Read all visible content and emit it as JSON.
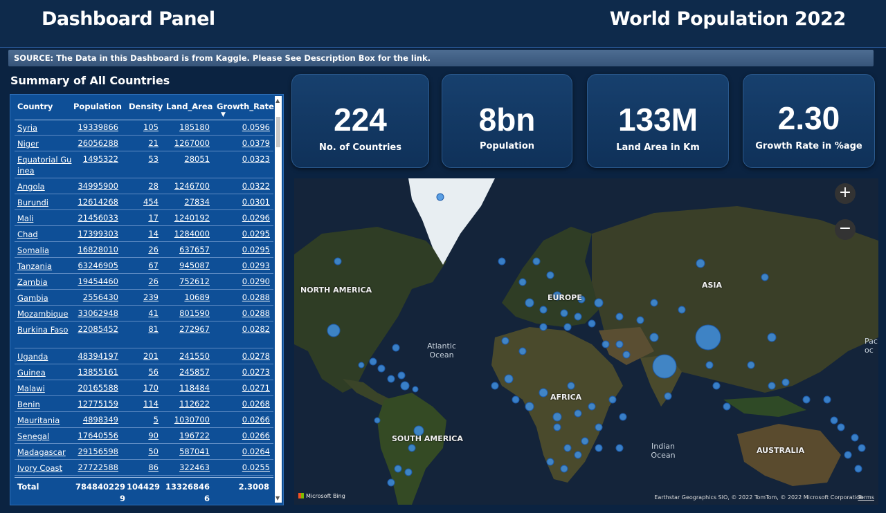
{
  "header": {
    "left_title": "Dashboard Panel",
    "right_title": "World Population 2022"
  },
  "source_text": "SOURCE: The Data in this Dashboard is from Kaggle. Please See Description Box for the link.",
  "summary": {
    "title": "Summary of All Countries",
    "columns": [
      "Country",
      "Population",
      "Density",
      "Land_Area",
      "Growth_Rate"
    ],
    "sorted_column": "Growth_Rate",
    "rows": [
      {
        "country": "Syria",
        "population": "19339866",
        "density": "105",
        "land_area": "185180",
        "growth_rate": "0.0596"
      },
      {
        "country": "Niger",
        "population": "26056288",
        "density": "21",
        "land_area": "1267000",
        "growth_rate": "0.0379"
      },
      {
        "country": "Equatorial Guinea",
        "population": "1495322",
        "density": "53",
        "land_area": "28051",
        "growth_rate": "0.0323"
      },
      {
        "country": "Angola",
        "population": "34995900",
        "density": "28",
        "land_area": "1246700",
        "growth_rate": "0.0322"
      },
      {
        "country": "Burundi",
        "population": "12614268",
        "density": "454",
        "land_area": "27834",
        "growth_rate": "0.0301"
      },
      {
        "country": "Mali",
        "population": "21456033",
        "density": "17",
        "land_area": "1240192",
        "growth_rate": "0.0296"
      },
      {
        "country": "Chad",
        "population": "17399303",
        "density": "14",
        "land_area": "1284000",
        "growth_rate": "0.0295"
      },
      {
        "country": "Somalia",
        "population": "16828010",
        "density": "26",
        "land_area": "637657",
        "growth_rate": "0.0295"
      },
      {
        "country": "Tanzania",
        "population": "63246905",
        "density": "67",
        "land_area": "945087",
        "growth_rate": "0.0293"
      },
      {
        "country": "Zambia",
        "population": "19454460",
        "density": "26",
        "land_area": "752612",
        "growth_rate": "0.0290"
      },
      {
        "country": "Gambia",
        "population": "2556430",
        "density": "239",
        "land_area": "10689",
        "growth_rate": "0.0288"
      },
      {
        "country": "Mozambique",
        "population": "33062948",
        "density": "41",
        "land_area": "801590",
        "growth_rate": "0.0288"
      },
      {
        "country": "Burkina Faso",
        "population": "22085452",
        "density": "81",
        "land_area": "272967",
        "growth_rate": "0.0282"
      },
      {
        "country": "Uganda",
        "population": "48394197",
        "density": "201",
        "land_area": "241550",
        "growth_rate": "0.0278"
      },
      {
        "country": "Guinea",
        "population": "13855161",
        "density": "56",
        "land_area": "245857",
        "growth_rate": "0.0273"
      },
      {
        "country": "Malawi",
        "population": "20165588",
        "density": "170",
        "land_area": "118484",
        "growth_rate": "0.0271"
      },
      {
        "country": "Benin",
        "population": "12775159",
        "density": "114",
        "land_area": "112622",
        "growth_rate": "0.0268"
      },
      {
        "country": "Mauritania",
        "population": "4898349",
        "density": "5",
        "land_area": "1030700",
        "growth_rate": "0.0266"
      },
      {
        "country": "Senegal",
        "population": "17640556",
        "density": "90",
        "land_area": "196722",
        "growth_rate": "0.0266"
      },
      {
        "country": "Madagascar",
        "population": "29156598",
        "density": "50",
        "land_area": "587041",
        "growth_rate": "0.0264"
      },
      {
        "country": "Ivory Coast",
        "population": "27722588",
        "density": "86",
        "land_area": "322463",
        "growth_rate": "0.0255"
      }
    ],
    "total": {
      "label": "Total",
      "population": "7848402299",
      "density": "104429",
      "land_area": "133268466",
      "growth_rate": "2.3008"
    }
  },
  "kpis": [
    {
      "value": "224",
      "label": "No. of Countries"
    },
    {
      "value": "8bn",
      "label": "Population"
    },
    {
      "value": "133M",
      "label": "Land Area in Km"
    },
    {
      "value": "2.30",
      "label": "Growth Rate in %age"
    }
  ],
  "map": {
    "labels": {
      "north_america": "NORTH AMERICA",
      "europe": "EUROPE",
      "asia": "ASIA",
      "africa": "AFRICA",
      "south_america": "SOUTH AMERICA",
      "australia": "AUSTRALIA",
      "atlantic": "Atlantic Ocean",
      "indian": "Indian Ocean",
      "pacific": "Pac oc"
    },
    "zoom_in": "+",
    "zoom_out": "−",
    "provider": "Microsoft Bing",
    "attribution": "Earthstar Geographics SIO, © 2022 TomTom, © 2022 Microsoft Corporation",
    "terms": "Terms",
    "colors": {
      "land": "#2f3d25",
      "ocean": "#14243a",
      "bubble": "#3f8fe0",
      "ice": "#e8eef2"
    }
  }
}
